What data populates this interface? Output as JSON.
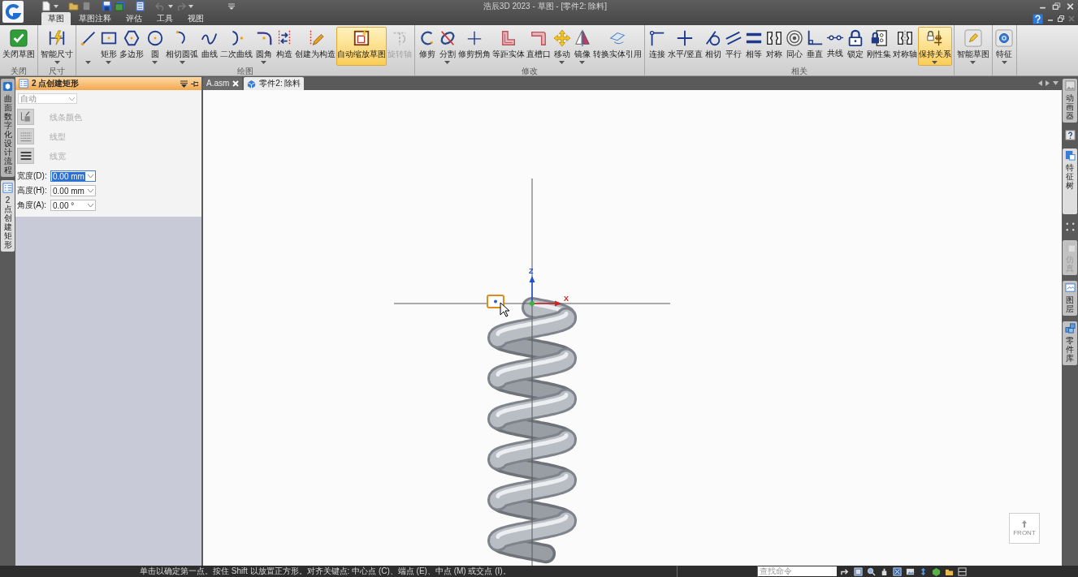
{
  "window": {
    "title": "浩辰3D 2023 - 草图 - [零件2: 除料]"
  },
  "ribbon_tabs": [
    {
      "label": "草图",
      "selected": true
    },
    {
      "label": "草图注释",
      "selected": false
    },
    {
      "label": "评估",
      "selected": false
    },
    {
      "label": "工具",
      "selected": false
    },
    {
      "label": "视图",
      "selected": false
    }
  ],
  "ribbon_groups": [
    {
      "label": "关闭",
      "tools": [
        {
          "label": "关闭草图",
          "on": false,
          "disabled": false,
          "menu": false
        }
      ]
    },
    {
      "label": "尺寸",
      "tools": [
        {
          "label": "智能尺寸",
          "on": false,
          "disabled": false,
          "menu": true
        }
      ]
    },
    {
      "label": "绘图",
      "tools": [
        {
          "on": false,
          "disabled": false,
          "menu": true
        },
        {
          "label": "矩形",
          "on": false,
          "disabled": false,
          "menu": true
        },
        {
          "label": "多边形",
          "on": false,
          "disabled": false,
          "menu": false
        },
        {
          "label": "圆",
          "on": false,
          "disabled": false,
          "menu": true
        },
        {
          "label": "相切圆弧",
          "on": false,
          "disabled": false,
          "menu": true
        },
        {
          "label": "曲线",
          "on": false,
          "disabled": false,
          "menu": false
        },
        {
          "label": "二次曲线",
          "on": false,
          "disabled": false,
          "menu": false
        },
        {
          "label": "圆角",
          "on": false,
          "disabled": false,
          "menu": true
        },
        {
          "label": "构造",
          "on": false,
          "disabled": false,
          "menu": false
        },
        {
          "label": "创建为构造",
          "on": false,
          "disabled": false,
          "menu": false
        },
        {
          "label": "自动缩放草图",
          "on": true,
          "disabled": false,
          "menu": false
        },
        {
          "label": "旋转轴",
          "on": false,
          "disabled": true,
          "menu": false
        }
      ]
    },
    {
      "label": "修改",
      "tools": [
        {
          "label": "修剪",
          "on": false,
          "disabled": false,
          "menu": false
        },
        {
          "label": "分割",
          "on": false,
          "disabled": false,
          "menu": true
        },
        {
          "label": "修剪拐角",
          "on": false,
          "disabled": false,
          "menu": false
        },
        {
          "label": "等距实体",
          "on": false,
          "disabled": false,
          "menu": false
        },
        {
          "label": "直槽口",
          "on": false,
          "disabled": false,
          "menu": false
        },
        {
          "label": "移动",
          "on": false,
          "disabled": false,
          "menu": true
        },
        {
          "label": "镜像",
          "on": false,
          "disabled": false,
          "menu": true
        },
        {
          "label": "转换实体引用",
          "on": false,
          "disabled": false,
          "menu": false
        }
      ]
    },
    {
      "label": "相关",
      "tools": [
        {
          "label": "连接",
          "on": false,
          "disabled": false,
          "menu": false
        },
        {
          "label": "水平/竖直",
          "on": false,
          "disabled": false,
          "menu": false
        },
        {
          "label": "相切",
          "on": false,
          "disabled": false,
          "menu": false
        },
        {
          "label": "平行",
          "on": false,
          "disabled": false,
          "menu": false
        },
        {
          "label": "相等",
          "on": false,
          "disabled": false,
          "menu": false
        },
        {
          "label": "对称",
          "on": false,
          "disabled": false,
          "menu": false
        },
        {
          "label": "同心",
          "on": false,
          "disabled": false,
          "menu": false
        },
        {
          "label": "垂直",
          "on": false,
          "disabled": false,
          "menu": false
        },
        {
          "label": "共线",
          "on": false,
          "disabled": false,
          "menu": false
        },
        {
          "label": "锁定",
          "on": false,
          "disabled": false,
          "menu": false
        },
        {
          "label": "刚性集",
          "on": false,
          "disabled": false,
          "menu": false
        },
        {
          "label": "对称轴",
          "on": false,
          "disabled": false,
          "menu": false
        },
        {
          "label": "保持关系",
          "on": true,
          "disabled": false,
          "menu": true
        }
      ]
    },
    {
      "tools": [
        {
          "label": "智能草图",
          "on": false,
          "disabled": false,
          "menu": true
        }
      ]
    },
    {
      "tools": [
        {
          "label": "特征",
          "on": false,
          "disabled": false,
          "menu": true
        }
      ]
    }
  ],
  "side_tabs": [
    {
      "label": "曲面数字化设计流程",
      "selected": false
    },
    {
      "label": "2 点创建矩形",
      "selected": true
    }
  ],
  "command_panel": {
    "title": "2 点创建矩形",
    "mode_dropdown": {
      "value": "自动",
      "disabled": true
    },
    "style_buttons": [
      {
        "label": "线条颜色",
        "disabled": true
      },
      {
        "label": "线型",
        "disabled": true
      },
      {
        "label": "线宽",
        "disabled": true
      }
    ],
    "fields": [
      {
        "label": "宽度(D):",
        "value": "0.00 mm",
        "selected": true
      },
      {
        "label": "高度(H):",
        "value": "0.00 mm",
        "selected": false
      },
      {
        "label": "角度(A):",
        "value": "0.00 °",
        "selected": false
      }
    ]
  },
  "document_tabs": [
    {
      "label": "A.asm",
      "selected": false,
      "closable": true
    },
    {
      "label": "零件2: 除料",
      "selected": true,
      "closable": false
    }
  ],
  "canvas": {
    "triad": {
      "z_label": "Z",
      "x_label": "X"
    },
    "view_cube": {
      "label": "FRONT"
    }
  },
  "right_tabs": [
    {
      "kind": "labeled",
      "label": "动画器",
      "selected": false,
      "disabled": false
    },
    {
      "kind": "icon",
      "selected": false,
      "disabled": false
    },
    {
      "kind": "labeled",
      "label": "特征树",
      "selected": true,
      "disabled": false
    },
    {
      "kind": "icon",
      "selected": false,
      "disabled": false
    },
    {
      "kind": "labeled",
      "label": "仿真",
      "selected": false,
      "disabled": true
    },
    {
      "kind": "labeled",
      "label": "图层",
      "selected": false,
      "disabled": false
    },
    {
      "kind": "labeled",
      "label": "零件库",
      "selected": false,
      "disabled": false
    }
  ],
  "status_bar": {
    "prompt": "单击以确定第一点。按住 Shift 以放置正方形。对齐关键点: 中心点 (C)、端点 (E)、中点 (M) 或交点 (I)。",
    "command_search": {
      "placeholder": "查找命令"
    }
  }
}
